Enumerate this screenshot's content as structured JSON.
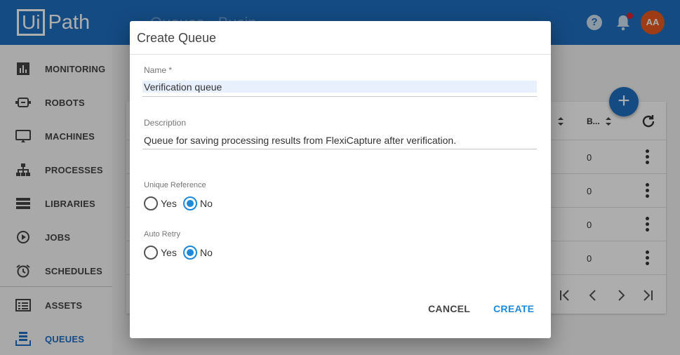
{
  "header": {
    "logo_ui": "Ui",
    "logo_path": "Path",
    "title": "Queues · Busin...",
    "avatar_initials": "AA",
    "help_glyph": "?",
    "brand_color": "#1e6fc2"
  },
  "sidebar": {
    "items": [
      {
        "label": "MONITORING",
        "icon": "monitoring-icon"
      },
      {
        "label": "ROBOTS",
        "icon": "robot-icon"
      },
      {
        "label": "MACHINES",
        "icon": "monitor-icon"
      },
      {
        "label": "PROCESSES",
        "icon": "sitemap-icon"
      },
      {
        "label": "LIBRARIES",
        "icon": "library-icon"
      },
      {
        "label": "JOBS",
        "icon": "play-icon"
      },
      {
        "label": "SCHEDULES",
        "icon": "alarm-clock-icon"
      },
      {
        "label": "ASSETS",
        "icon": "assets-icon"
      },
      {
        "label": "QUEUES",
        "icon": "queues-icon"
      }
    ],
    "active": "QUEUES"
  },
  "table": {
    "column_b": "B...",
    "rows": [
      "0",
      "0",
      "0",
      "0"
    ]
  },
  "fab_glyph": "+",
  "dialog": {
    "title": "Create Queue",
    "name_label": "Name *",
    "name_value": "Verification queue",
    "description_label": "Description",
    "description_value": "Queue for saving processing results from FlexiCapture after verification.",
    "unique_reference": {
      "label": "Unique Reference",
      "yes": "Yes",
      "no": "No",
      "selected": "No"
    },
    "auto_retry": {
      "label": "Auto Retry",
      "yes": "Yes",
      "no": "No",
      "selected": "No"
    },
    "cancel_label": "CANCEL",
    "create_label": "CREATE",
    "accent_color": "#1e88d9"
  }
}
